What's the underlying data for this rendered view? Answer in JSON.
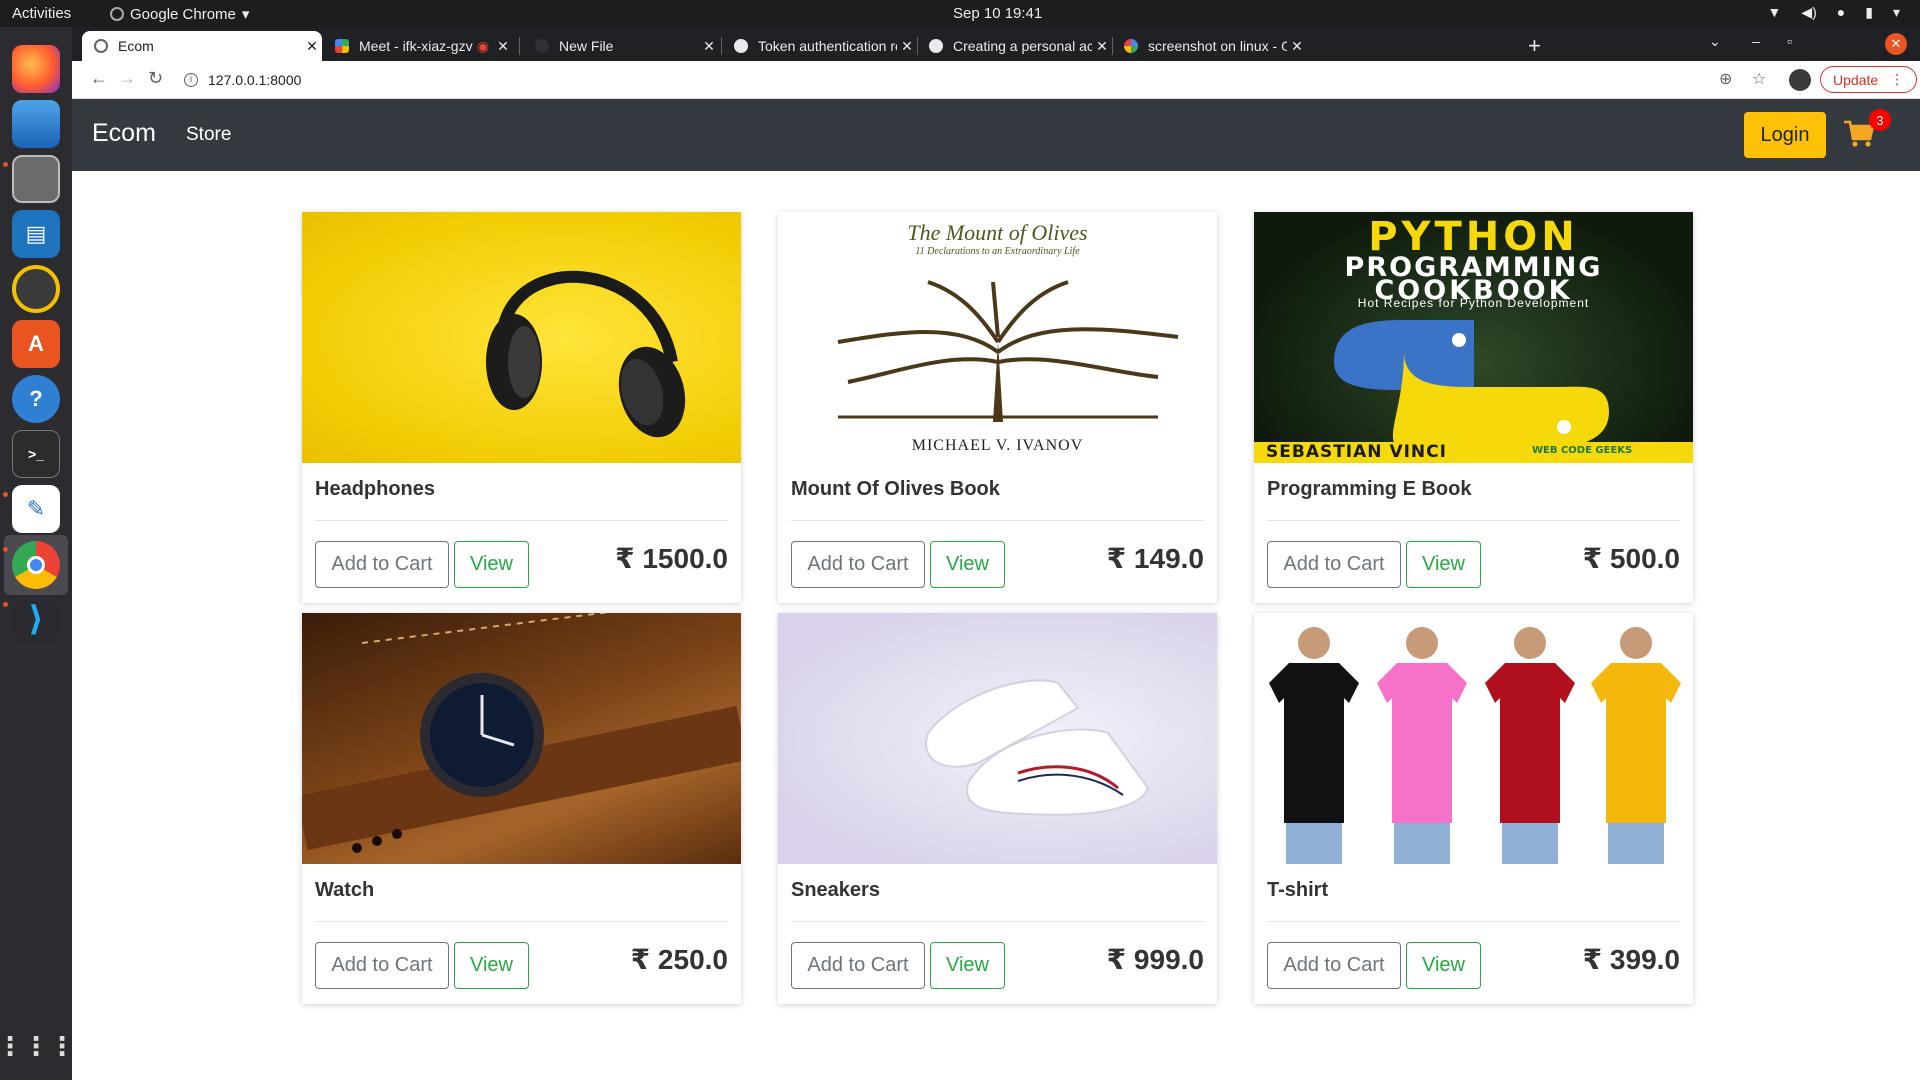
{
  "system": {
    "activities": "Activities",
    "app_name": "Google Chrome",
    "clock": "Sep 10  19:41"
  },
  "browser": {
    "tabs": [
      {
        "title": "Ecom",
        "active": true
      },
      {
        "title": "Meet - ifk-xiaz-gzv",
        "active": false
      },
      {
        "title": "New File",
        "active": false
      },
      {
        "title": "Token authentication req",
        "active": false
      },
      {
        "title": "Creating a personal acces",
        "active": false
      },
      {
        "title": "screenshot on linux - Goo",
        "active": false
      }
    ],
    "url": "127.0.0.1:8000",
    "update_label": "Update"
  },
  "site": {
    "brand": "Ecom",
    "nav_store": "Store",
    "login_label": "Login",
    "cart_count": "3"
  },
  "labels": {
    "add_to_cart": "Add to Cart",
    "view": "View"
  },
  "products": [
    {
      "name": "Headphones",
      "price": "₹ 1500.0"
    },
    {
      "name": "Mount Of Olives Book",
      "price": "₹ 149.0"
    },
    {
      "name": "Programming E Book",
      "price": "₹ 500.0"
    },
    {
      "name": "Watch",
      "price": "₹ 250.0"
    },
    {
      "name": "Sneakers",
      "price": "₹ 999.0"
    },
    {
      "name": "T-shirt",
      "price": "₹ 399.0"
    }
  ],
  "images": {
    "book1_title": "The Mount of Olives",
    "book1_subtitle": "11 Declarations to an Extraordinary Life",
    "book1_author": "MICHAEL V. IVANOV",
    "book2_title_1": "PYTHON",
    "book2_title_2": "PROGRAMMING",
    "book2_title_3": "COOKBOOK",
    "book2_subtitle": "Hot Recipes for Python Development",
    "book2_author": "SEBASTIAN VINCI",
    "book2_publisher": "WEB CODE GEEKS"
  },
  "colors": {
    "navbar": "#343a40",
    "login": "#ffc107",
    "view_green": "#28a745",
    "badge_red": "#ff0000"
  }
}
